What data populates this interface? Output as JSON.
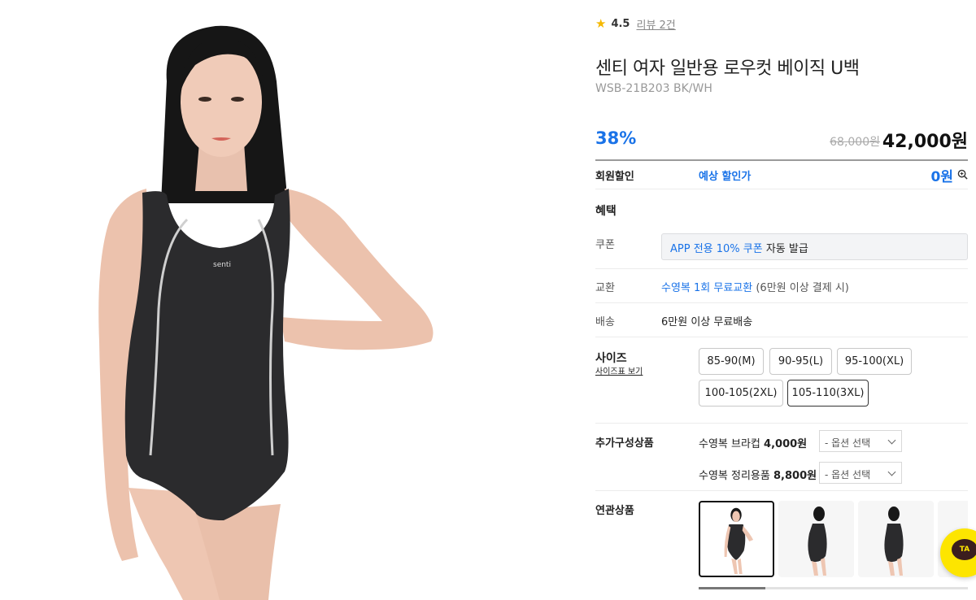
{
  "product": {
    "rating": "4.5",
    "review_link": "리뷰 2건",
    "title": "센티 여자 일반용 로우컷 베이직 U백",
    "model_code": "WSB-21B203 BK/WH",
    "discount_rate": "38%",
    "original_price": "68,000원",
    "sale_price": "42,000원",
    "image_logo_text": "senti"
  },
  "member_discount": {
    "label": "회원할인",
    "expected_label": "예상 할인가",
    "amount": "0원"
  },
  "benefits": {
    "title": "혜택",
    "coupon_label": "쿠폰",
    "coupon_highlight": "APP 전용 10% 쿠폰",
    "coupon_rest": " 자동 발급",
    "exchange_label": "교환",
    "exchange_highlight": "수영복 1회 무료교환",
    "exchange_rest": " (6만원 이상 결제 시)",
    "shipping_label": "배송",
    "shipping_text": "6만원 이상 무료배송"
  },
  "size": {
    "label": "사이즈",
    "chart_link": "사이즈표 보기",
    "options": [
      "85-90(M)",
      "90-95(L)",
      "95-100(XL)",
      "100-105(2XL)",
      "105-110(3XL)"
    ],
    "selected": "105-110(3XL)"
  },
  "addons": {
    "label": "추가구성상품",
    "items": [
      {
        "name": "수영복 브라컵",
        "price": "4,000원",
        "select_placeholder": "- 옵션 선택"
      },
      {
        "name": "수영복 정리용품",
        "price": "8,800원",
        "select_placeholder": "- 옵션 선택"
      }
    ]
  },
  "related": {
    "label": "연관상품",
    "thumbs": [
      "front-view",
      "side-view",
      "side-view-2",
      "partial"
    ]
  },
  "floating_talk": {
    "label": "TA"
  },
  "colors": {
    "accent_blue": "#1a73e8",
    "star": "#f5b800",
    "talk_yellow": "#fde500",
    "swimsuit": "#2b2b2d"
  }
}
